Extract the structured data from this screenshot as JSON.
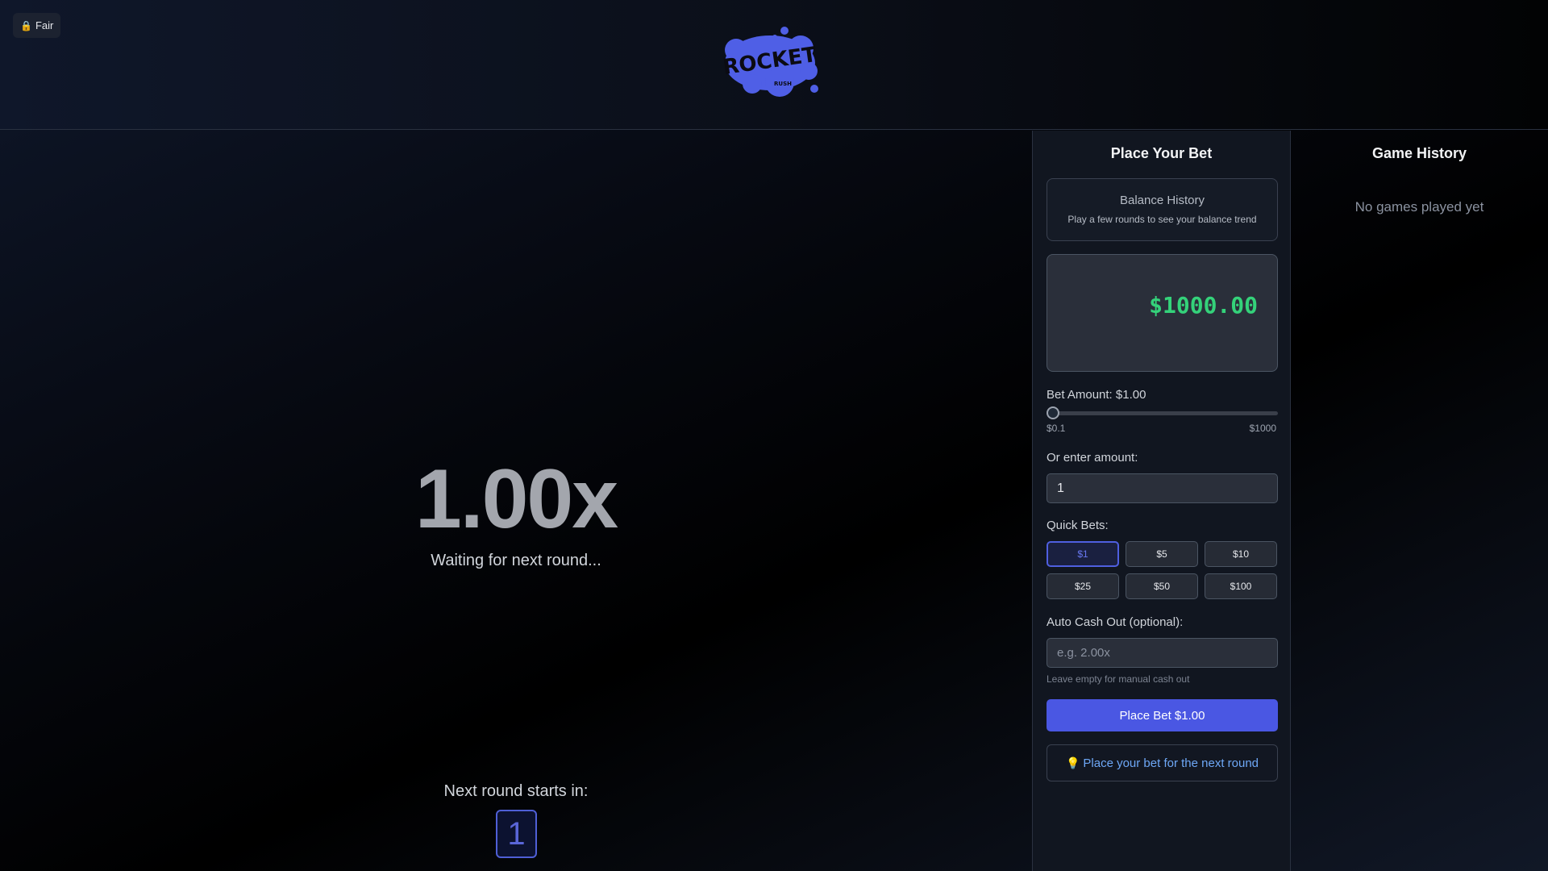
{
  "header": {
    "fair_badge": "Fair",
    "lock_icon": "lock-icon",
    "logo_text": "ROCKET",
    "logo_subtext": "RUSH",
    "logo_color": "#4f5fe6"
  },
  "game": {
    "multiplier": "1.00x",
    "status": "Waiting for next round...",
    "next_round_label": "Next round starts in:",
    "countdown": "1"
  },
  "bet_panel": {
    "title": "Place Your Bet",
    "balance_history": {
      "title": "Balance History",
      "subtitle": "Play a few rounds to see your balance trend"
    },
    "balance": "$1000.00",
    "bet_amount_label": "Bet Amount: $1.00",
    "slider": {
      "min_label": "$0.1",
      "max_label": "$1000",
      "value": 1
    },
    "enter_amount_label": "Or enter amount:",
    "amount_value": "1",
    "quick_bets_label": "Quick Bets:",
    "quick_bets": [
      "$1",
      "$5",
      "$10",
      "$25",
      "$50",
      "$100"
    ],
    "quick_bet_selected": "$1",
    "auto_cashout_label": "Auto Cash Out (optional):",
    "auto_cashout_placeholder": "e.g. 2.00x",
    "auto_cashout_hint": "Leave empty for manual cash out",
    "place_bet_label": "Place Bet $1.00",
    "tip_icon": "lightbulb-icon",
    "tip_text": "Place your bet for the next round"
  },
  "history_panel": {
    "title": "Game History",
    "empty_text": "No games played yet"
  },
  "colors": {
    "accent": "#4a57e3",
    "balance_green": "#34d27a",
    "tip_blue": "#6ea8f7"
  }
}
